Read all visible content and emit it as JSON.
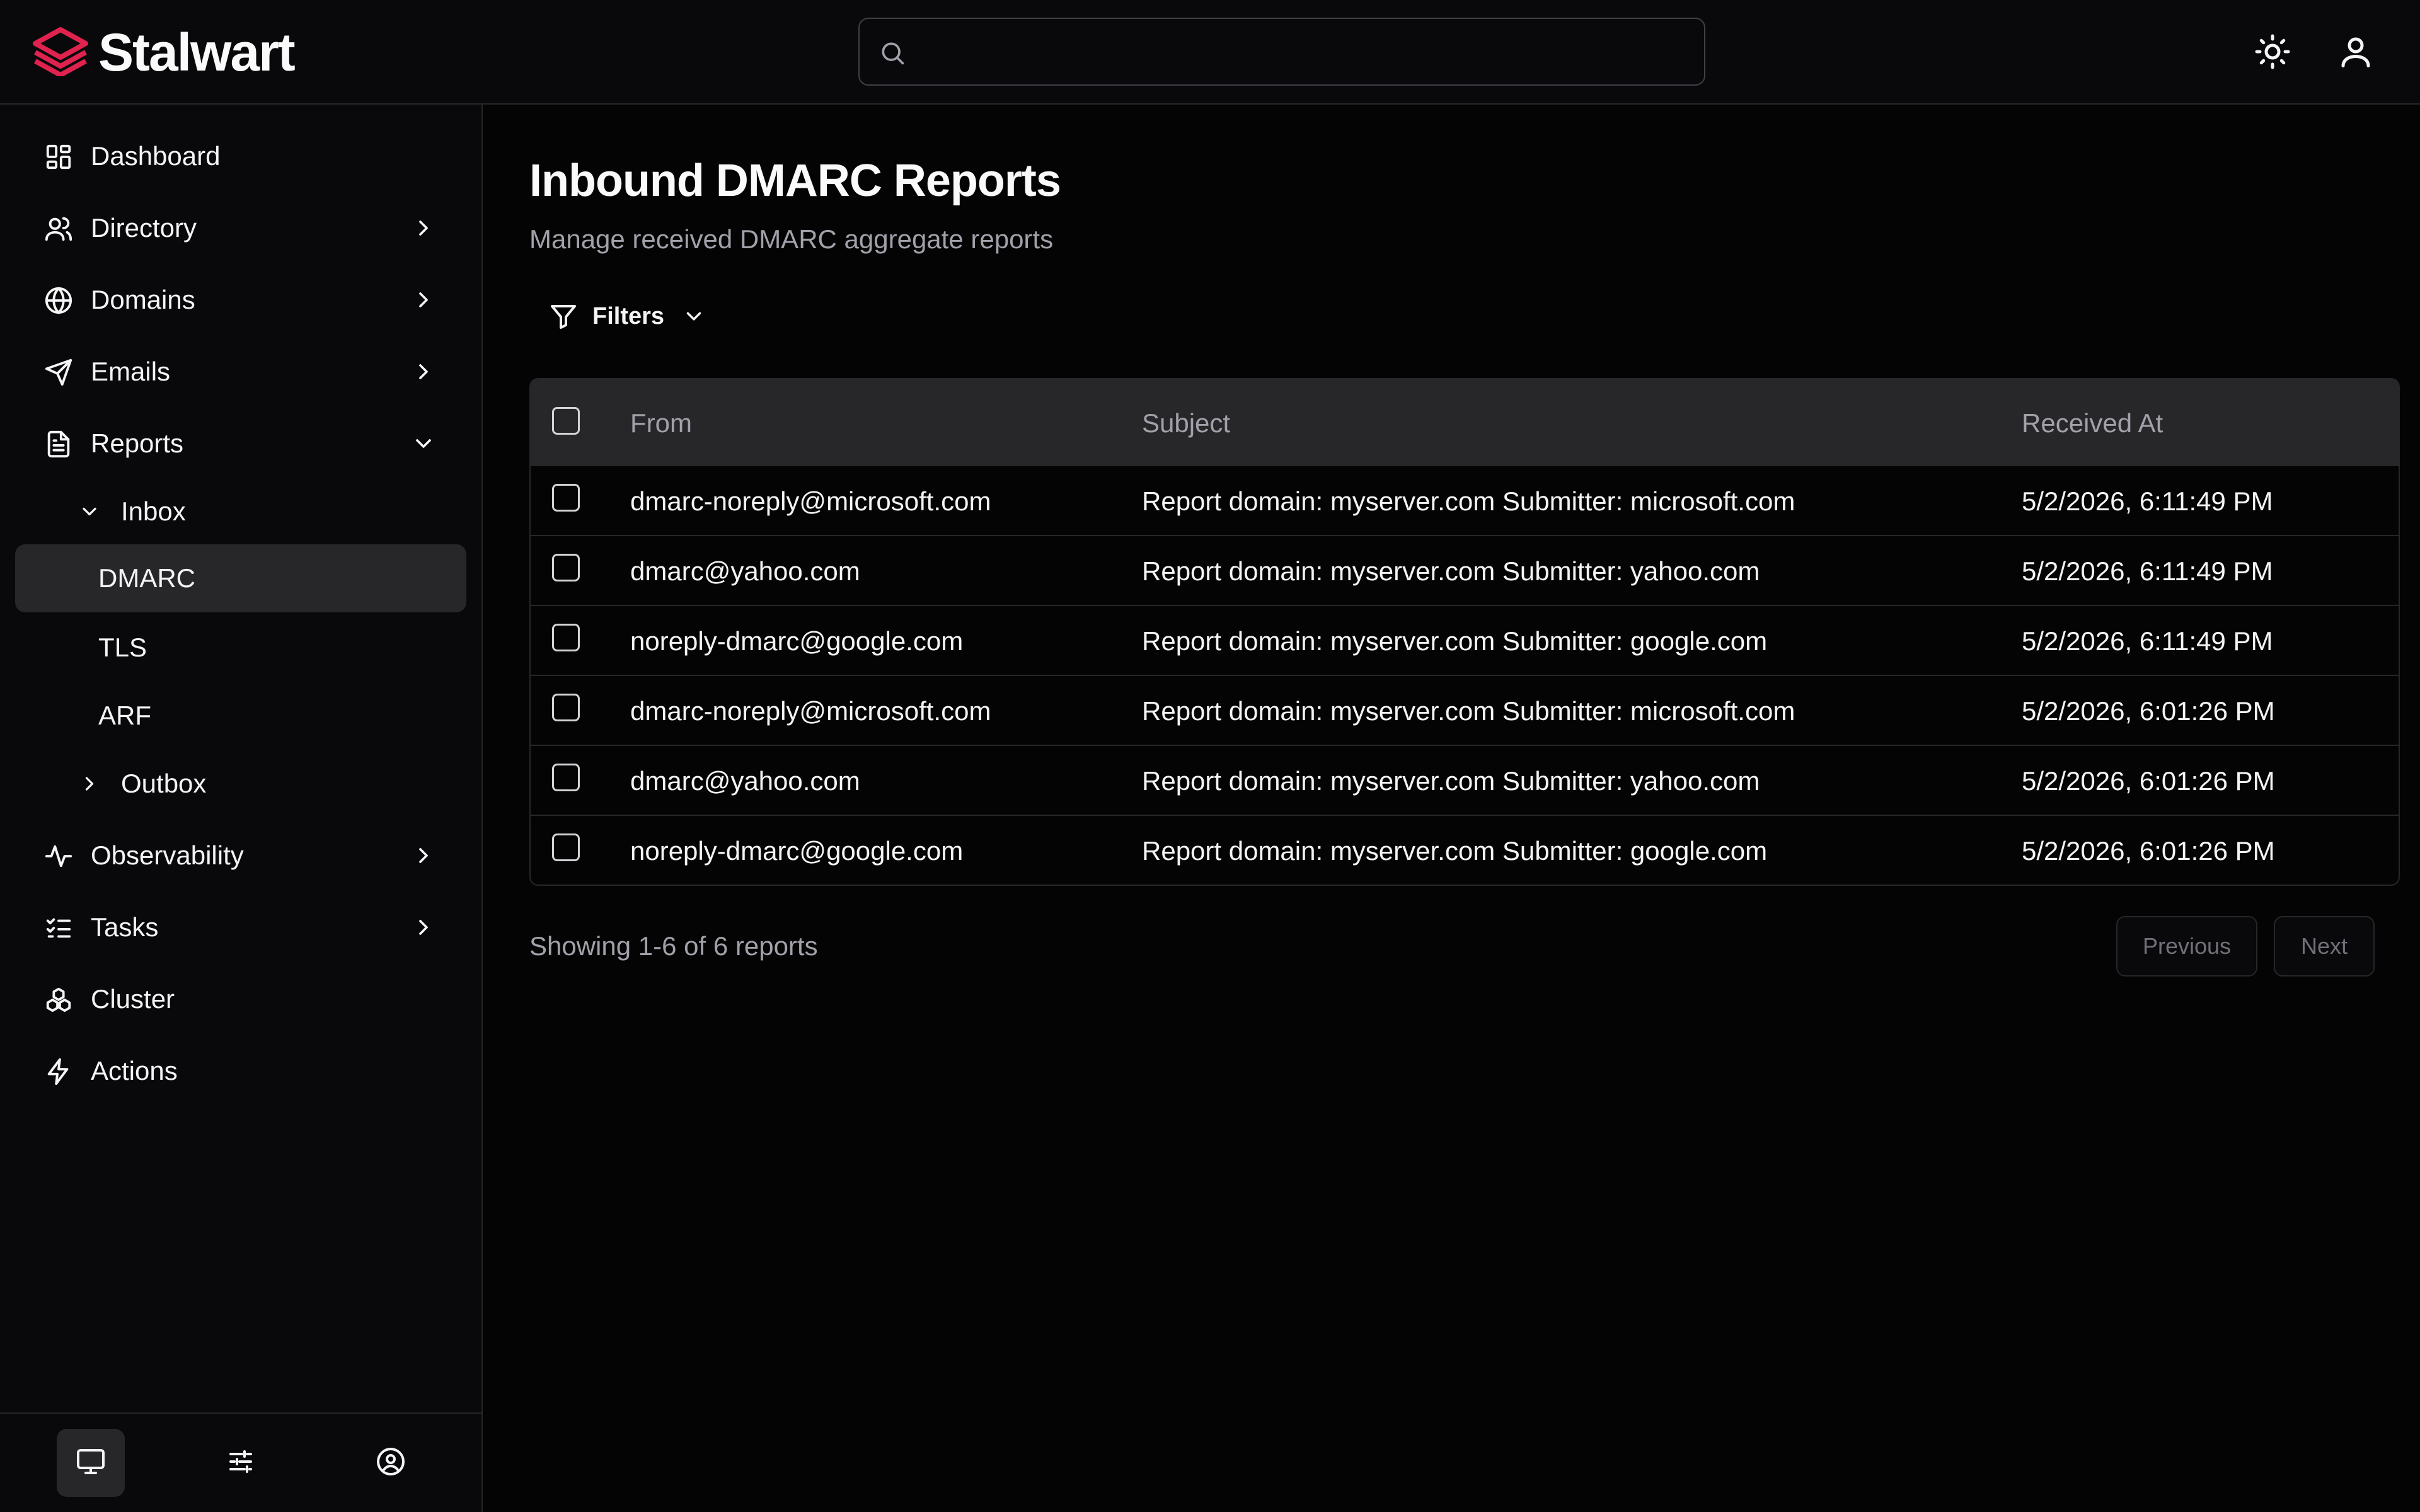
{
  "header": {
    "brand": "Stalwart",
    "brand_color": "#e0224e",
    "search_placeholder": "",
    "icons": [
      "search-icon",
      "sun-icon",
      "user-icon"
    ]
  },
  "sidebar": {
    "items": [
      {
        "label": "Dashboard",
        "icon": "dashboard-icon"
      },
      {
        "label": "Directory",
        "icon": "users-icon"
      },
      {
        "label": "Domains",
        "icon": "globe-icon"
      },
      {
        "label": "Emails",
        "icon": "send-icon"
      },
      {
        "label": "Reports",
        "icon": "file-text-icon"
      },
      {
        "label": "Inbox",
        "icon": "chevron-down-icon"
      },
      {
        "label": "DMARC"
      },
      {
        "label": "TLS"
      },
      {
        "label": "ARF"
      },
      {
        "label": "Outbox",
        "icon": "chevron-right-icon"
      },
      {
        "label": "Observability",
        "icon": "activity-icon"
      },
      {
        "label": "Tasks",
        "icon": "list-checks-icon"
      },
      {
        "label": "Cluster",
        "icon": "cluster-icon"
      },
      {
        "label": "Actions",
        "icon": "zap-icon"
      }
    ],
    "active": "DMARC",
    "footer_icons": [
      "monitor-icon",
      "sliders-icon",
      "user-circle-icon"
    ]
  },
  "main": {
    "title": "Inbound DMARC Reports",
    "subtitle": "Manage received DMARC aggregate reports",
    "filters_label": "Filters",
    "table": {
      "columns": [
        "From",
        "Subject",
        "Received At"
      ],
      "rows": [
        {
          "from": "dmarc-noreply@microsoft.com",
          "subject": "Report domain: myserver.com Submitter: microsoft.com",
          "received": "5/2/2026, 6:11:49 PM"
        },
        {
          "from": "dmarc@yahoo.com",
          "subject": "Report domain: myserver.com Submitter: yahoo.com",
          "received": "5/2/2026, 6:11:49 PM"
        },
        {
          "from": "noreply-dmarc@google.com",
          "subject": "Report domain: myserver.com Submitter: google.com",
          "received": "5/2/2026, 6:11:49 PM"
        },
        {
          "from": "dmarc-noreply@microsoft.com",
          "subject": "Report domain: myserver.com Submitter: microsoft.com",
          "received": "5/2/2026, 6:01:26 PM"
        },
        {
          "from": "dmarc@yahoo.com",
          "subject": "Report domain: myserver.com Submitter: yahoo.com",
          "received": "5/2/2026, 6:01:26 PM"
        },
        {
          "from": "noreply-dmarc@google.com",
          "subject": "Report domain: myserver.com Submitter: google.com",
          "received": "5/2/2026, 6:01:26 PM"
        }
      ]
    },
    "pagination": {
      "summary": "Showing 1-6 of 6 reports",
      "previous": "Previous",
      "next": "Next"
    }
  }
}
